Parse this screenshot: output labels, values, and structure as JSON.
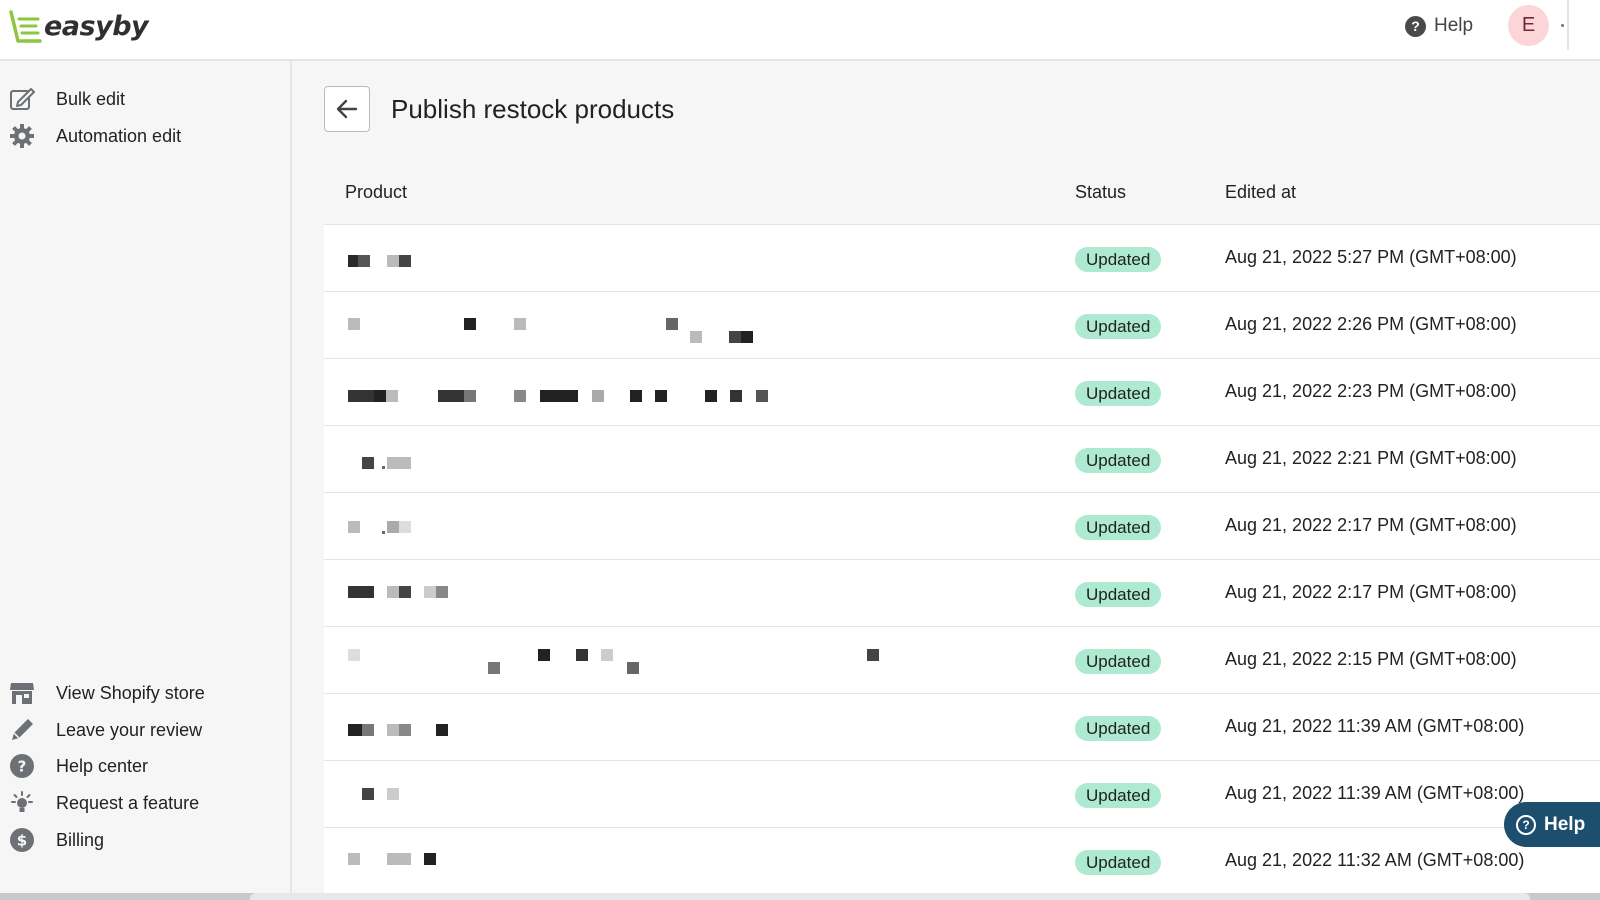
{
  "app": {
    "logo_text": "easyby",
    "brand_color": "#8dc63f",
    "help_label": "Help",
    "avatar_initial": "E"
  },
  "sidebar": {
    "top_items": [
      {
        "label": "Bulk edit",
        "icon": "edit-icon"
      },
      {
        "label": "Automation edit",
        "icon": "gear-icon"
      }
    ],
    "bottom_items": [
      {
        "label": "View Shopify store",
        "icon": "store-icon"
      },
      {
        "label": "Leave your review",
        "icon": "pencil-icon"
      },
      {
        "label": "Help center",
        "icon": "question-icon"
      },
      {
        "label": "Request a feature",
        "icon": "lightbulb-icon"
      },
      {
        "label": "Billing",
        "icon": "dollar-icon"
      }
    ]
  },
  "page": {
    "title": "Publish restock products",
    "back_icon": "arrow-left-icon"
  },
  "table": {
    "columns": {
      "product": "Product",
      "status": "Status",
      "edited_at": "Edited at"
    },
    "rows": [
      {
        "product": "",
        "status": "Updated",
        "edited_at": "Aug 21, 2022 5:27 PM (GMT+08:00)"
      },
      {
        "product": "",
        "status": "Updated",
        "edited_at": "Aug 21, 2022 2:26 PM (GMT+08:00)"
      },
      {
        "product": "",
        "status": "Updated",
        "edited_at": "Aug 21, 2022 2:23 PM (GMT+08:00)"
      },
      {
        "product": "",
        "status": "Updated",
        "edited_at": "Aug 21, 2022 2:21 PM (GMT+08:00)"
      },
      {
        "product": "",
        "status": "Updated",
        "edited_at": "Aug 21, 2022 2:17 PM (GMT+08:00)"
      },
      {
        "product": "",
        "status": "Updated",
        "edited_at": "Aug 21, 2022 2:17 PM (GMT+08:00)"
      },
      {
        "product": "",
        "status": "Updated",
        "edited_at": "Aug 21, 2022 2:15 PM (GMT+08:00)"
      },
      {
        "product": "",
        "status": "Updated",
        "edited_at": "Aug 21, 2022 11:39 AM (GMT+08:00)"
      },
      {
        "product": "",
        "status": "Updated",
        "edited_at": "Aug 21, 2022 11:39 AM (GMT+08:00)"
      },
      {
        "product": "",
        "status": "Updated",
        "edited_at": "Aug 21, 2022 11:32 AM (GMT+08:00)"
      }
    ],
    "status_badge_color": "#aee9d1"
  },
  "floating_help": {
    "label": "Help",
    "color": "#1e4e6e"
  }
}
